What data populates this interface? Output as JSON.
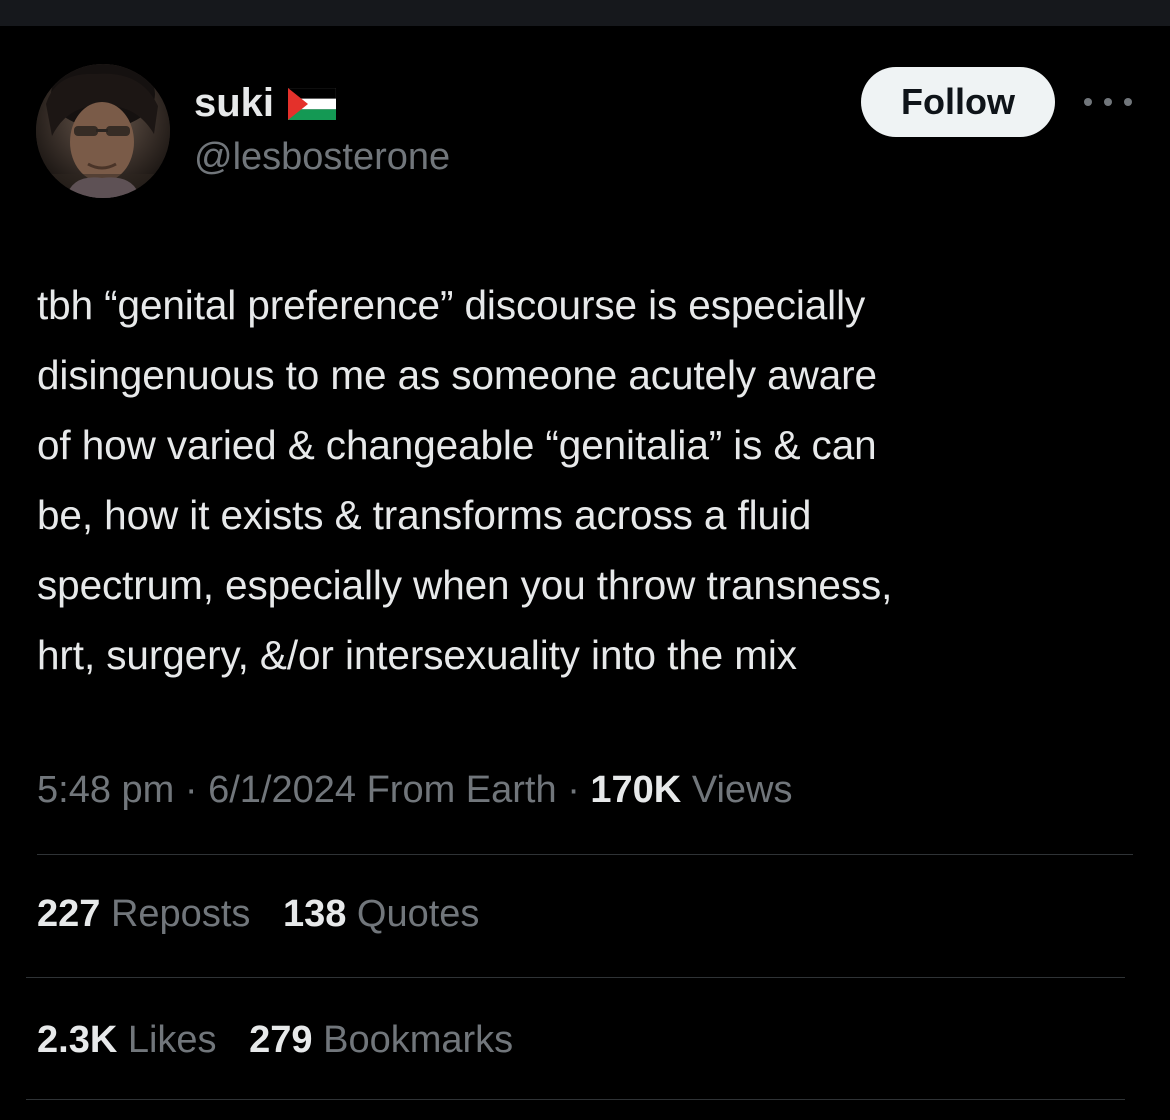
{
  "colors": {
    "background": "#000000",
    "primary_text": "#e7e9ea",
    "secondary_text": "#71767b",
    "divider": "#2f3336",
    "follow_button_bg": "#eff3f4",
    "follow_button_text": "#0f1419"
  },
  "author": {
    "display_name": "suki",
    "flag_icon": "palestine-flag",
    "handle": "@lesbosterone",
    "avatar_icon": "profile-photo"
  },
  "header": {
    "follow_label": "Follow",
    "more_icon": "more-horizontal-icon"
  },
  "tweet": {
    "text": "tbh “genital preference” discourse is especially\ndisingenuous to me as someone acutely aware\nof how varied & changeable “genitalia” is & can\nbe, how it exists & transforms across a fluid\nspectrum, especially when you throw transness,\nhrt, surgery, &/or intersexuality into the mix"
  },
  "meta": {
    "time": "5:48 pm",
    "separator": "·",
    "date": "6/1/2024",
    "source": "From Earth",
    "views_count": "170K",
    "views_label": "Views"
  },
  "stats": {
    "reposts": {
      "count": "227",
      "label": "Reposts"
    },
    "quotes": {
      "count": "138",
      "label": "Quotes"
    },
    "likes": {
      "count": "2.3K",
      "label": "Likes"
    },
    "bookmarks": {
      "count": "279",
      "label": "Bookmarks"
    }
  }
}
